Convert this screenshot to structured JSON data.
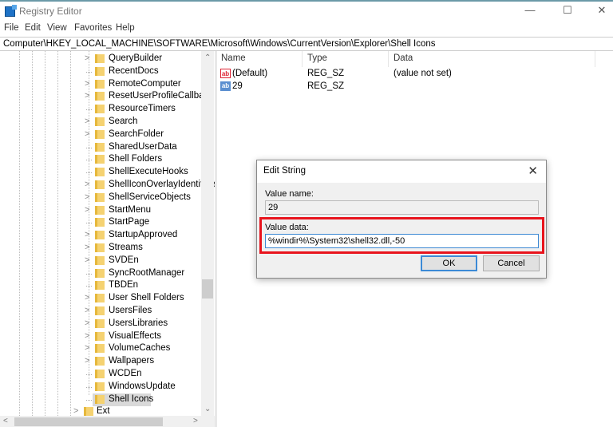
{
  "window": {
    "title": "Registry Editor",
    "minimize": "—",
    "maximize": "☐",
    "close": "✕"
  },
  "menu": [
    "File",
    "Edit",
    "View",
    "Favorites",
    "Help"
  ],
  "address": "Computer\\HKEY_LOCAL_MACHINE\\SOFTWARE\\Microsoft\\Windows\\CurrentVersion\\Explorer\\Shell Icons",
  "tree": [
    {
      "label": "QueryBuilder",
      "expandable": true
    },
    {
      "label": "RecentDocs",
      "expandable": false
    },
    {
      "label": "RemoteComputer",
      "expandable": true
    },
    {
      "label": "ResetUserProfileCallback",
      "expandable": true
    },
    {
      "label": "ResourceTimers",
      "expandable": false
    },
    {
      "label": "Search",
      "expandable": true
    },
    {
      "label": "SearchFolder",
      "expandable": true
    },
    {
      "label": "SharedUserData",
      "expandable": false
    },
    {
      "label": "Shell Folders",
      "expandable": false
    },
    {
      "label": "ShellExecuteHooks",
      "expandable": false
    },
    {
      "label": "ShellIconOverlayIdentifiers",
      "expandable": true
    },
    {
      "label": "ShellServiceObjects",
      "expandable": true
    },
    {
      "label": "StartMenu",
      "expandable": true
    },
    {
      "label": "StartPage",
      "expandable": false
    },
    {
      "label": "StartupApproved",
      "expandable": true
    },
    {
      "label": "Streams",
      "expandable": true
    },
    {
      "label": "SVDEn",
      "expandable": true
    },
    {
      "label": "SyncRootManager",
      "expandable": false
    },
    {
      "label": "TBDEn",
      "expandable": false
    },
    {
      "label": "User Shell Folders",
      "expandable": true
    },
    {
      "label": "UsersFiles",
      "expandable": true
    },
    {
      "label": "UsersLibraries",
      "expandable": true
    },
    {
      "label": "VisualEffects",
      "expandable": true
    },
    {
      "label": "VolumeCaches",
      "expandable": true
    },
    {
      "label": "Wallpapers",
      "expandable": true
    },
    {
      "label": "WCDEn",
      "expandable": false
    },
    {
      "label": "WindowsUpdate",
      "expandable": false
    },
    {
      "label": "Shell Icons",
      "expandable": false,
      "selected": true
    }
  ],
  "tree_parent_sibling": {
    "label": "Ext"
  },
  "list": {
    "columns": [
      "Name",
      "Type",
      "Data"
    ],
    "rows": [
      {
        "name": "(Default)",
        "type": "REG_SZ",
        "data": "(value not set)",
        "icon": "ab"
      },
      {
        "name": "29",
        "type": "REG_SZ",
        "data": "",
        "icon": "ab"
      }
    ]
  },
  "dialog": {
    "title": "Edit String",
    "value_name_label": "Value name:",
    "value_name": "29",
    "value_data_label": "Value data:",
    "value_data": "%windir%\\System32\\shell32.dll,-50",
    "ok": "OK",
    "cancel": "Cancel",
    "close": "✕"
  },
  "colors": {
    "highlight": "#e8141d",
    "accent": "#3c8ad6"
  }
}
